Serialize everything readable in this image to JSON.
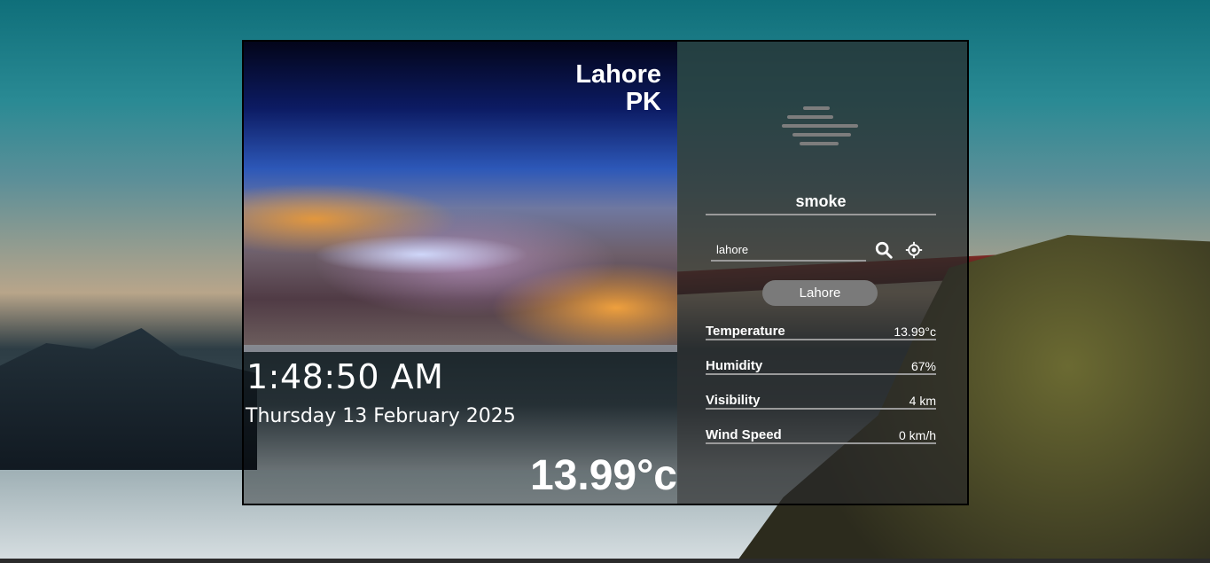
{
  "location": {
    "city": "Lahore",
    "country": "PK"
  },
  "time": "1:48:50 AM",
  "date": "Thursday 13 February 2025",
  "temperature_display": "13.99°c",
  "condition": "smoke",
  "condition_icon": "haze-icon",
  "search": {
    "value": "lahore",
    "placeholder": "lahore"
  },
  "city_pill": "Lahore",
  "stats": [
    {
      "label": "Temperature",
      "value": "13.99°c"
    },
    {
      "label": "Humidity",
      "value": "67%"
    },
    {
      "label": "Visibility",
      "value": "4 km"
    },
    {
      "label": "Wind Speed",
      "value": "0 km/h"
    }
  ]
}
